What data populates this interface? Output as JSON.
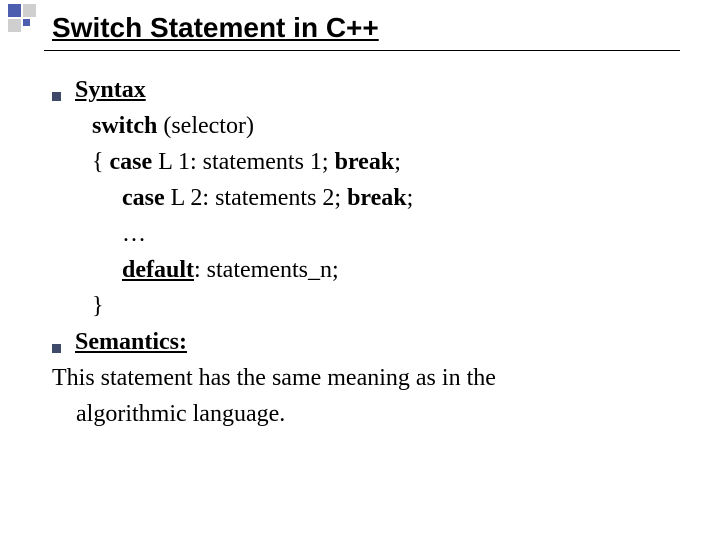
{
  "title": "Switch Statement in C++",
  "bullet1": "Syntax",
  "line_switch_kw": "switch",
  "line_switch_arg": " (selector)",
  "line_open": "{ ",
  "line_case1_kw": "case",
  "line_case1_mid": " L 1: statements 1; ",
  "line_case1_brk": "break",
  "line_case1_end": ";",
  "line_case2_kw": "case",
  "line_case2_mid": " L 2: statements 2; ",
  "line_case2_brk": "break",
  "line_case2_end": ";",
  "line_dots": "…",
  "line_default_kw": "default",
  "line_default_rest": ": statements_n;",
  "line_close": "}",
  "bullet2": "Semantics:",
  "semantics_text_1": "This statement has the same meaning as in the",
  "semantics_text_2": "algorithmic language."
}
